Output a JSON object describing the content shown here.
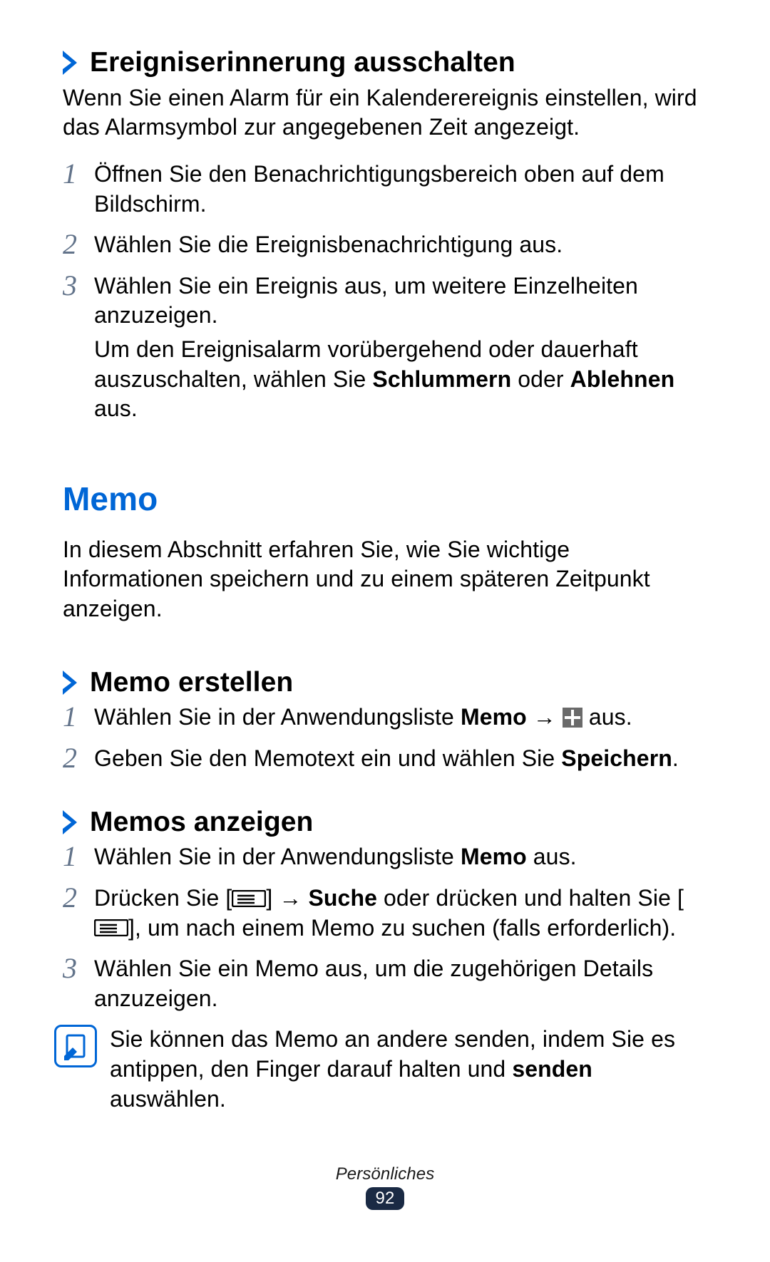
{
  "sections": {
    "s1": {
      "title": "Ereigniserinnerung ausschalten",
      "intro": "Wenn Sie einen Alarm für ein Kalenderereignis einstellen, wird das Alarmsymbol zur angegebenen Zeit angezeigt.",
      "steps": {
        "n1": "1",
        "t1": "Öffnen Sie den Benachrichtigungsbereich oben auf dem Bildschirm.",
        "n2": "2",
        "t2": "Wählen Sie die Ereignisbenachrichtigung aus.",
        "n3": "3",
        "t3": "Wählen Sie ein Ereignis aus, um weitere Einzelheiten anzuzeigen.",
        "t3extra_a": "Um den Ereignisalarm vorübergehend oder dauerhaft auszuschalten, wählen Sie ",
        "t3extra_b1": "Schlummern",
        "t3extra_m": " oder ",
        "t3extra_b2": "Ablehnen",
        "t3extra_c": " aus."
      }
    },
    "memo": {
      "title": "Memo",
      "intro": "In diesem Abschnitt erfahren Sie, wie Sie wichtige Informationen speichern und zu einem späteren Zeitpunkt anzeigen."
    },
    "s2": {
      "title": "Memo erstellen",
      "steps": {
        "n1": "1",
        "t1a": "Wählen Sie in der Anwendungsliste ",
        "t1b": "Memo",
        "t1c": " → ",
        "t1d": " aus.",
        "n2": "2",
        "t2a": "Geben Sie den Memotext ein und wählen Sie ",
        "t2b": "Speichern",
        "t2c": "."
      }
    },
    "s3": {
      "title": "Memos anzeigen",
      "steps": {
        "n1": "1",
        "t1a": "Wählen Sie in der Anwendungsliste ",
        "t1b": "Memo",
        "t1c": " aus.",
        "n2": "2",
        "t2a": "Drücken Sie [",
        "t2b": "] → ",
        "t2c": "Suche",
        "t2d": " oder drücken und halten Sie [",
        "t2e": "], um nach einem Memo zu suchen (falls erforderlich).",
        "n3": "3",
        "t3": "Wählen Sie ein Memo aus, um die zugehörigen Details anzuzeigen."
      },
      "note_a": "Sie können das Memo an andere senden, indem Sie es antippen, den Finger darauf halten und ",
      "note_b": "senden",
      "note_c": " auswählen."
    }
  },
  "footer": {
    "category": "Persönliches",
    "page": "92"
  }
}
